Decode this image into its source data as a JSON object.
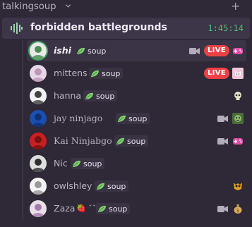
{
  "category": {
    "name": "talkingsoup"
  },
  "channel": {
    "name": "forbidden battlegrounds",
    "timer": "1:45:14"
  },
  "badge_label": "soup",
  "live_label": "LIVE",
  "members": [
    {
      "name": "ishi",
      "avatar_color": "#e9e9e9",
      "avatar_accent": "#2e7d32",
      "speaking": true,
      "camera": true,
      "live": true,
      "activity": "game-controller-icon"
    },
    {
      "name": "mittens",
      "avatar_color": "#e6d6e6",
      "avatar_accent": "#b58cb0",
      "speaking": false,
      "camera": false,
      "live": true,
      "activity": "cat-icon"
    },
    {
      "name": "hanna",
      "avatar_color": "#f2f2f2",
      "avatar_accent": "#222222",
      "speaking": false,
      "camera": false,
      "live": false,
      "activity": "skull-icon"
    },
    {
      "name": "jay ninjago",
      "avatar_color": "#1a4fb0",
      "avatar_accent": "#0d2c6b",
      "speaking": false,
      "camera": true,
      "live": false,
      "activity": "zombie-icon"
    },
    {
      "name": "Kai Ninjabgo",
      "avatar_color": "#c62020",
      "avatar_accent": "#6b0d0d",
      "speaking": false,
      "camera": true,
      "live": false,
      "activity": "game-controller-icon"
    },
    {
      "name": "Nic",
      "avatar_color": "#dedede",
      "avatar_accent": "#111111",
      "speaking": false,
      "camera": false,
      "live": false,
      "activity": ""
    },
    {
      "name": "owlshley",
      "avatar_color": "#f5f5f5",
      "avatar_accent": "#888888",
      "speaking": false,
      "camera": false,
      "live": false,
      "activity": "owl-icon"
    },
    {
      "name": "Zaza",
      "status_emoji": "🍓 ˇˇ",
      "avatar_color": "#e8dfe8",
      "avatar_accent": "#9a6aa0",
      "speaking": false,
      "camera": true,
      "live": false,
      "activity": "money-bag-icon"
    }
  ],
  "colors": {
    "live": "#ed4245",
    "speaking": "#3ba55c",
    "timer": "#4fbd6e",
    "leaf": "#7ccf6b"
  }
}
